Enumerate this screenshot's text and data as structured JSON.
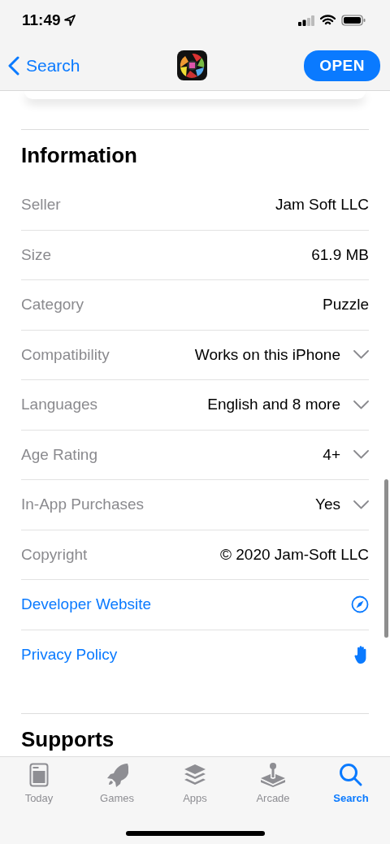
{
  "status_bar": {
    "time": "11:49"
  },
  "nav_bar": {
    "back_label": "Search",
    "open_button": "OPEN"
  },
  "information": {
    "title": "Information",
    "rows": [
      {
        "kind": "info",
        "label": "Seller",
        "value": "Jam Soft LLC"
      },
      {
        "kind": "info",
        "label": "Size",
        "value": "61.9 MB"
      },
      {
        "kind": "info",
        "label": "Category",
        "value": "Puzzle"
      },
      {
        "kind": "expand",
        "label": "Compatibility",
        "value": "Works on this iPhone",
        "expanded": false
      },
      {
        "kind": "expand",
        "label": "Languages",
        "value": "English and 8 more",
        "expanded": false
      },
      {
        "kind": "expand",
        "label": "Age Rating",
        "value": "4+",
        "expanded": false
      },
      {
        "kind": "expand",
        "label": "In-App Purchases",
        "value": "Yes",
        "expanded": false
      },
      {
        "kind": "info",
        "label": "Copyright",
        "value": "© 2020 Jam-Soft LLC"
      },
      {
        "kind": "link",
        "label": "Developer Website"
      },
      {
        "kind": "link",
        "label": "Privacy Policy"
      }
    ]
  },
  "supports": {
    "title": "Supports"
  },
  "tab_bar": [
    {
      "label": "Today",
      "selected": false
    },
    {
      "label": "Games",
      "selected": false
    },
    {
      "label": "Apps",
      "selected": false
    },
    {
      "label": "Arcade",
      "selected": false
    },
    {
      "label": "Search",
      "selected": true
    }
  ]
}
